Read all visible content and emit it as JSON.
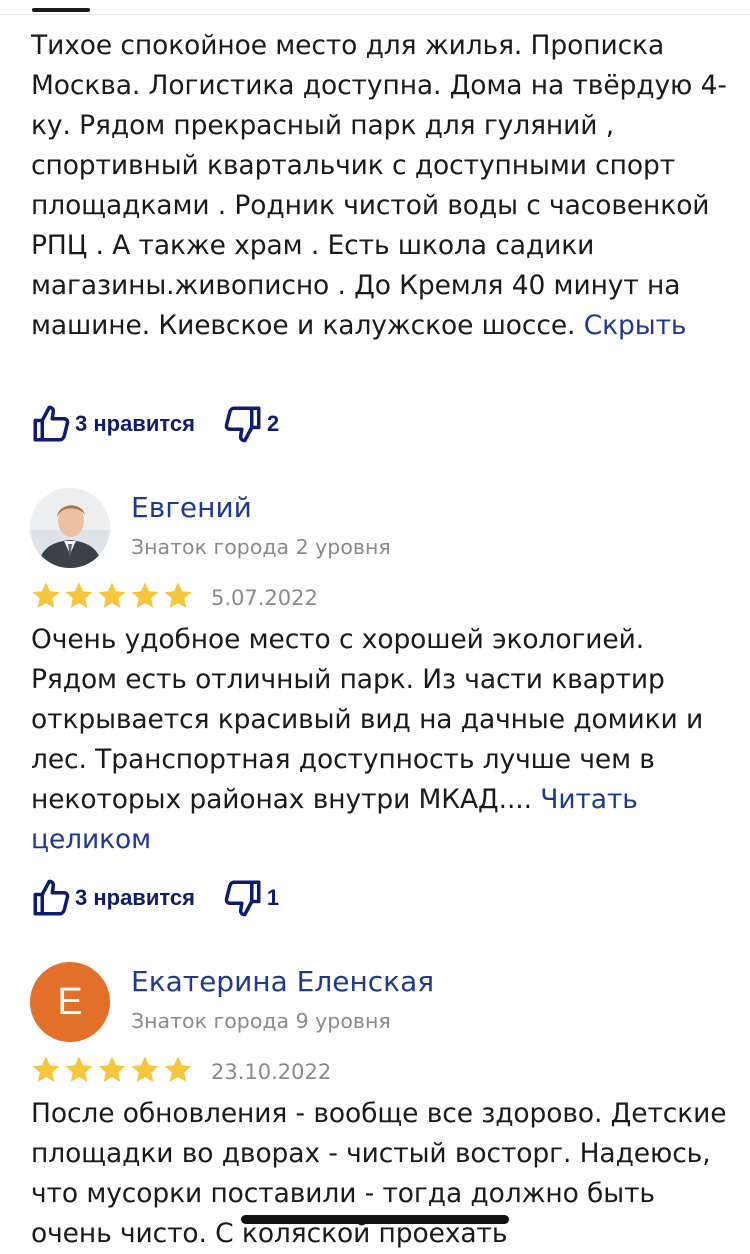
{
  "reviews": [
    {
      "text": "Тихое спокойное место для жилья. Прописка Москва. Логистика доступна. Дома на твёрдую 4-ку. Рядом прекрасный парк для гуляний , спортивный квартальчик с доступными спорт площадками . Родник чистой воды с часовенкой РПЦ . А также храм . Есть школа садики магазины.живописно . До Кремля 40 минут на машине. Киевское и калужское шоссе.",
      "toggle_label": "Скрыть",
      "likes_label": "3 нравится",
      "dislikes": "2"
    },
    {
      "author": "Евгений",
      "level": "Знаток города 2 уровня",
      "rating": 5,
      "date": "5.07.2022",
      "text": "Очень удобное место с хорошей экологией. Рядом есть отличный парк. Из части квартир открывается красивый вид на дачные домики и лес. Транспортная доступность лучше чем в некоторых районах внутри МКАД....",
      "toggle_label": "Читать целиком",
      "likes_label": "3 нравится",
      "dislikes": "1"
    },
    {
      "author": "Екатерина Еленская",
      "avatar_letter": "Е",
      "level": "Знаток города 9 уровня",
      "rating": 5,
      "date": "23.10.2022",
      "text": "После обновления - вообще все здорово. Детские площадки во дворах - чистый восторг. Надеюсь, что мусорки поставили - тогда должно быть очень чисто. С коляской проехать"
    }
  ],
  "colors": {
    "link": "#1d3a8f",
    "reaction": "#0f1c6e",
    "star": "#f5c73d",
    "avatar_bg": "#e26f2a",
    "muted": "#8a8a8a"
  },
  "icons": [
    "thumbs-up-icon",
    "thumbs-down-icon",
    "star-icon"
  ]
}
